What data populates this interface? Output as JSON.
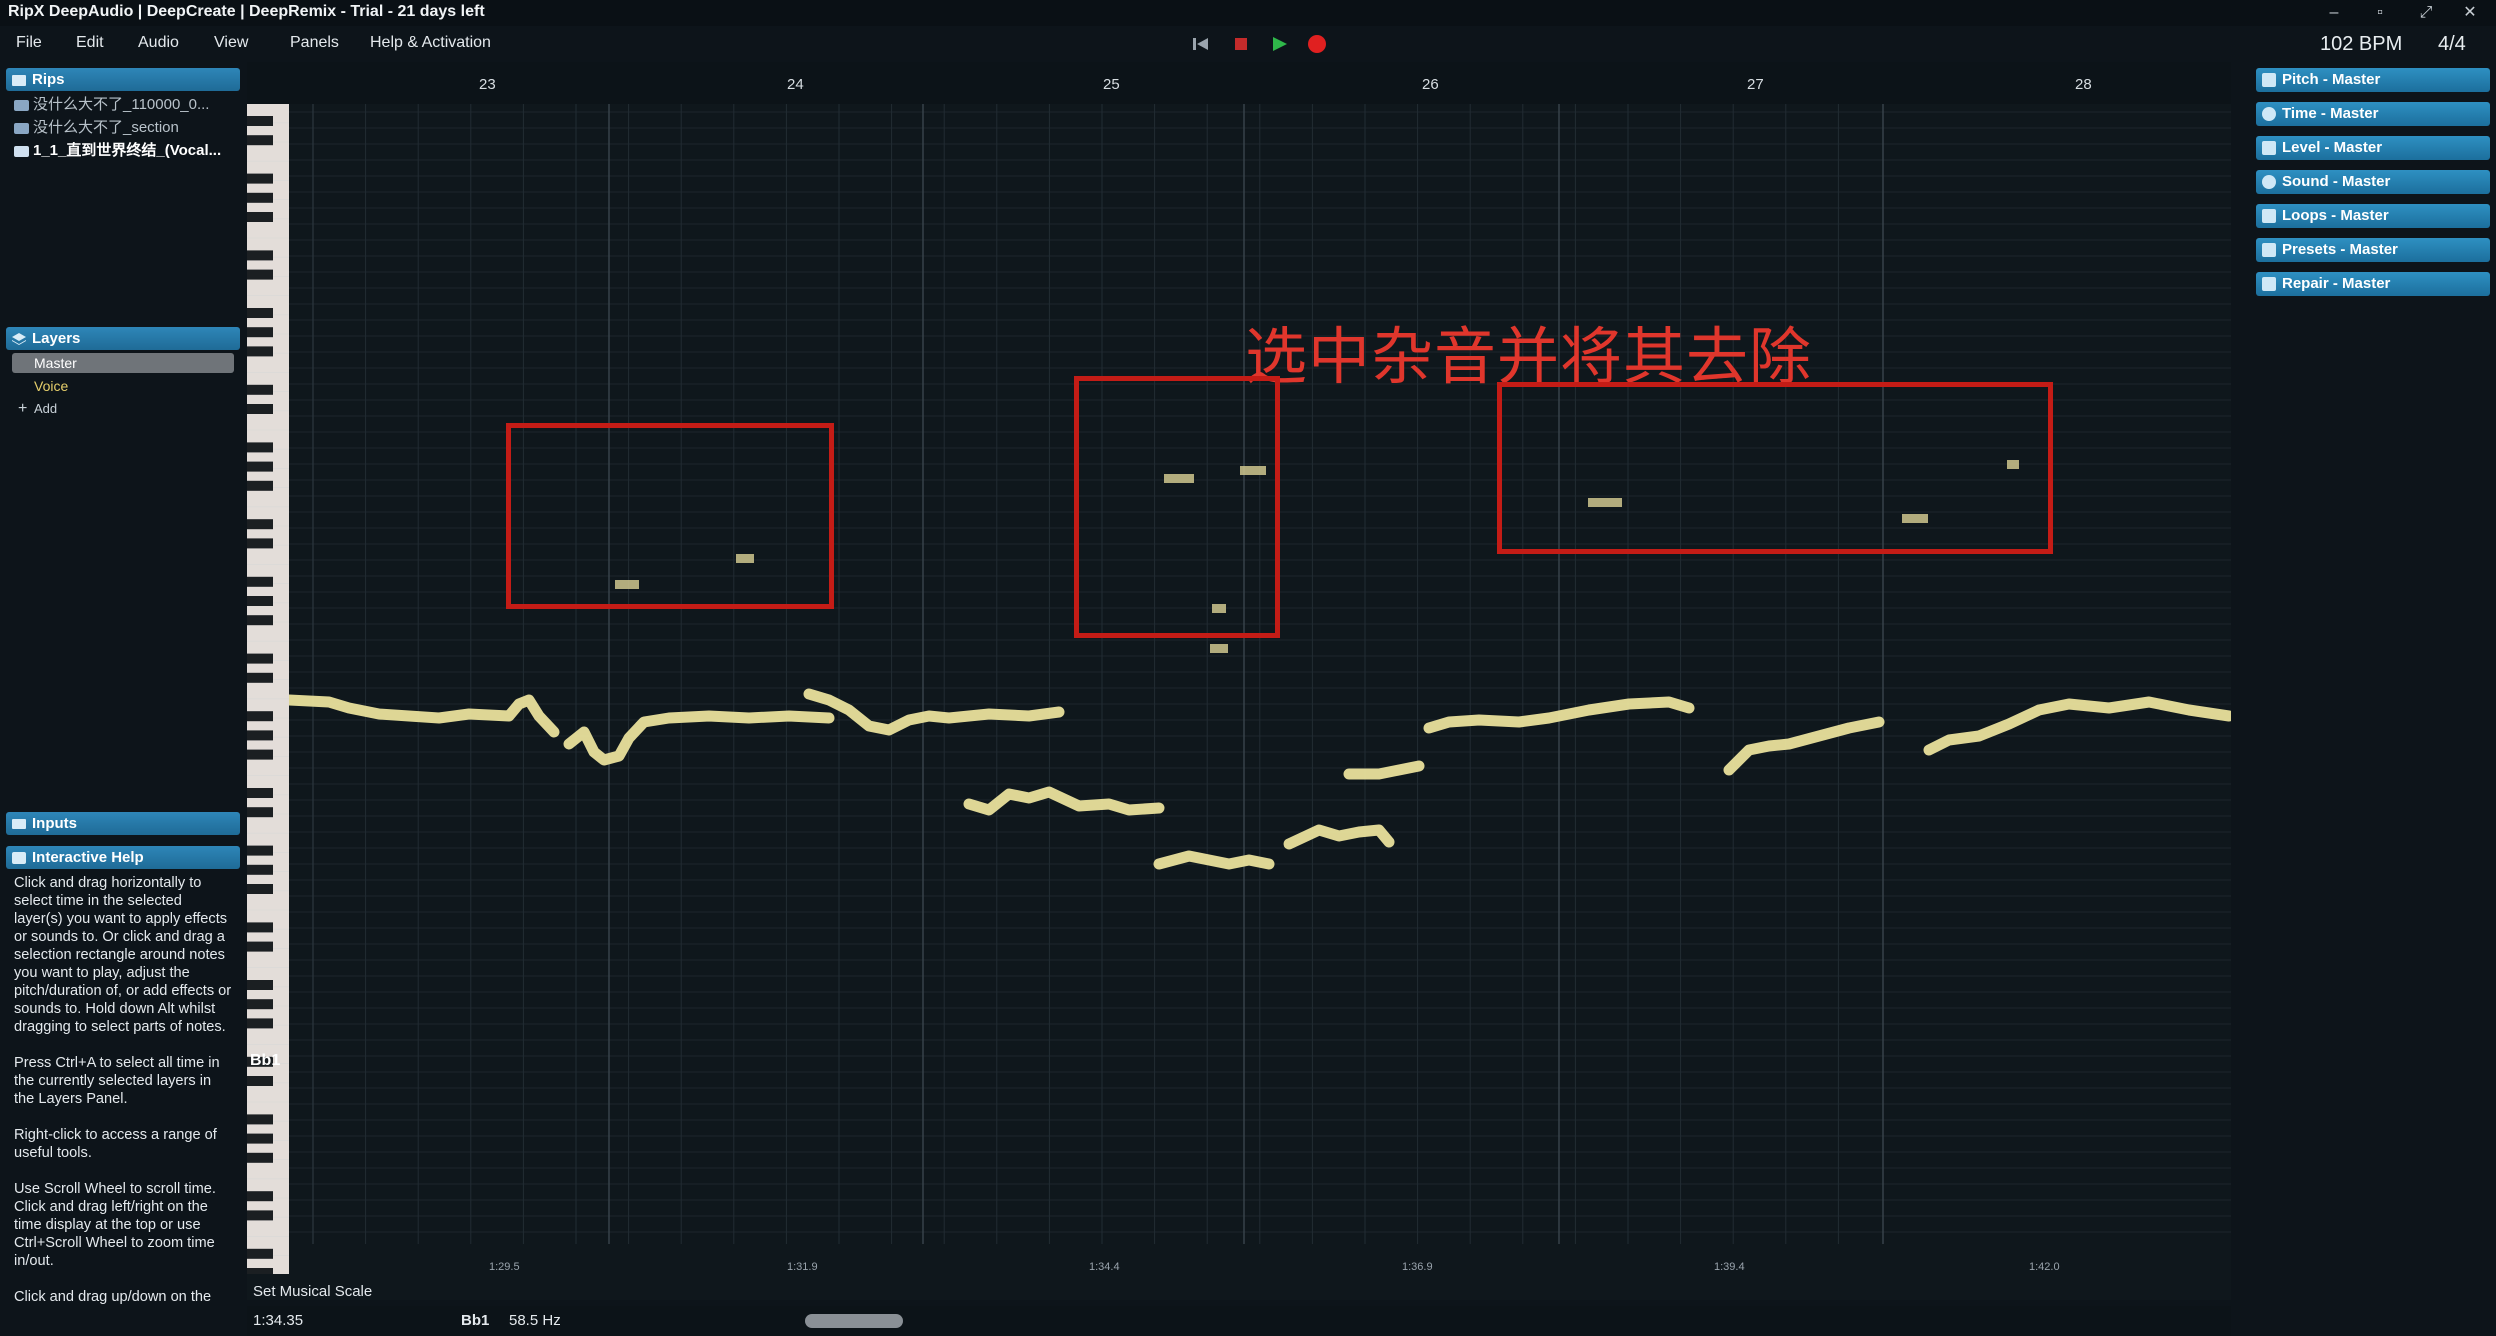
{
  "window": {
    "title": "RipX DeepAudio | DeepCreate | DeepRemix - Trial - 21 days left",
    "minimize_glyph": "–",
    "restore_glyph": "▫",
    "fullscreen_glyph": "⤢",
    "close_glyph": "✕"
  },
  "menu": {
    "items": [
      "File",
      "Edit",
      "Audio",
      "View",
      "Panels",
      "Help & Activation"
    ]
  },
  "transport": {
    "icons": [
      "skip-back-icon",
      "stop-icon",
      "play-icon",
      "record-icon"
    ],
    "stop_color": "#c42b2b",
    "play_color": "#2fb84a",
    "record_color": "#e02020"
  },
  "tempo": {
    "bpm": "102 BPM",
    "time_signature": "4/4"
  },
  "rips": {
    "header": "Rips",
    "items": [
      "没什么大不了_110000_0...",
      "没什么大不了_section",
      "1_1_直到世界终结_(Vocal..."
    ]
  },
  "layers": {
    "header": "Layers",
    "master": "Master",
    "voice": "Voice",
    "add": "Add"
  },
  "inputs": {
    "header": "Inputs"
  },
  "interactive_help": {
    "header": "Interactive Help",
    "text": "Click and drag horizontally to select time in the selected layer(s) you want to apply effects or sounds to. Or click and drag a selection rectangle around notes you want to play, adjust the pitch/duration of, or add effects or sounds to. Hold down Alt whilst dragging to select parts of notes.\n\nPress Ctrl+A to select all time in the currently selected layers in the Layers Panel.\n\nRight-click to access a range of useful tools.\n\nUse Scroll Wheel to scroll time. Click and drag left/right on the time display at the top or use Ctrl+Scroll Wheel to zoom time in/out.\n\nClick and drag up/down on the"
  },
  "ruler": {
    "bars": [
      "23",
      "24",
      "25",
      "26",
      "27",
      "28"
    ],
    "times": [
      "1:29.5",
      "1:31.9",
      "1:34.4",
      "1:36.9",
      "1:39.4",
      "1:42.0"
    ]
  },
  "annotation": {
    "text": "选中杂音并将其去除",
    "color": "#e0362c"
  },
  "pitch_label": "Bb1",
  "scale_button": "Set Musical Scale",
  "status": {
    "time": "1:34.35",
    "note": "Bb1",
    "frequency": "58.5 Hz"
  },
  "right_panels": [
    {
      "label": "Pitch - Master",
      "icon": "note-icon"
    },
    {
      "label": "Time - Master",
      "icon": "clock-icon"
    },
    {
      "label": "Level - Master",
      "icon": "level-icon"
    },
    {
      "label": "Sound - Master",
      "icon": "sound-icon"
    },
    {
      "label": "Loops - Master",
      "icon": "loops-icon"
    },
    {
      "label": "Presets - Master",
      "icon": "presets-icon"
    },
    {
      "label": "Repair - Master",
      "icon": "repair-icon"
    }
  ],
  "colors": {
    "accent": "#2e86b8",
    "note": "#f0e7a0",
    "annotation_box": "#c41c16"
  }
}
